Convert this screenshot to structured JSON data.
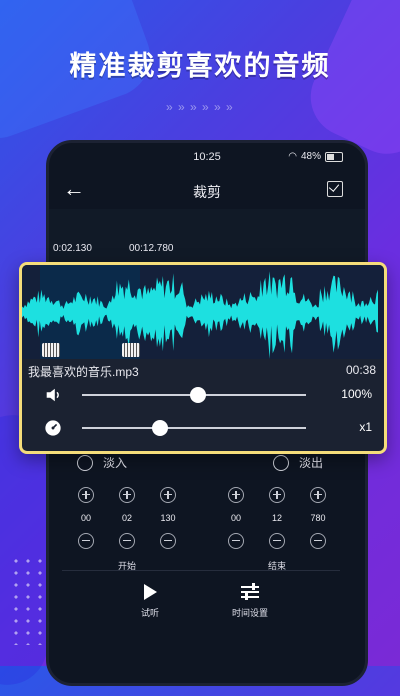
{
  "banner": {
    "title": "精准裁剪喜欢的音频",
    "chevrons": "» » » » » »"
  },
  "status_bar": {
    "time": "10:25",
    "battery": "48%"
  },
  "header": {
    "title": "裁剪"
  },
  "timeline": {
    "start_mark": "0:02.130",
    "end_mark": "00:12.780"
  },
  "track": {
    "file_name": "我最喜欢的音乐.mp3",
    "duration": "00:38",
    "volume_label": "100%",
    "volume_level": 0.52,
    "speed_label": "x1",
    "speed_level": 0.35
  },
  "fade": {
    "in_label": "淡入",
    "out_label": "淡出"
  },
  "start_time": {
    "label": "开始",
    "min": "00",
    "sec": "02",
    "ms": "130"
  },
  "end_time": {
    "label": "结束",
    "min": "00",
    "sec": "12",
    "ms": "780"
  },
  "actions": {
    "listen": "试听",
    "time_settings": "时间设置"
  },
  "colors": {
    "card_border": "#f5dd7a",
    "wave": "#1de0e0",
    "selection": "#0b2a4a"
  }
}
